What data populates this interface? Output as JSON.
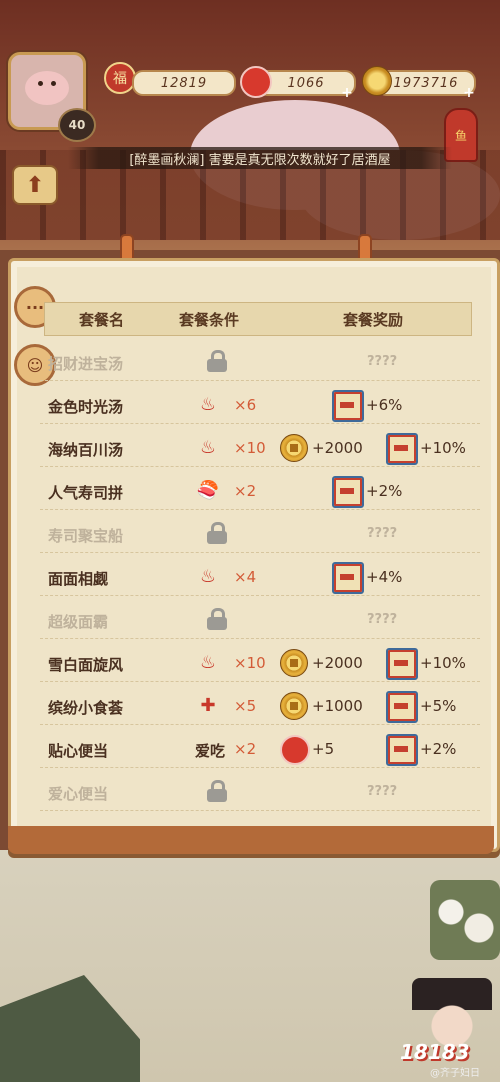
{
  "hud": {
    "level": "40",
    "flower_badge": "福",
    "score": "12819",
    "tickets": "1066",
    "coins": "1973716",
    "ticket_plus": "+",
    "coin_plus": "+",
    "fish_label": "鱼"
  },
  "banner": "[醉墨画秋澜] 害要是真无限次数就好了居酒屋",
  "table": {
    "col_name": "套餐名",
    "col_condition": "套餐条件",
    "col_reward": "套餐奖励",
    "rows": [
      {
        "name": "招财进宝汤",
        "locked": true,
        "reward": "????"
      },
      {
        "name": "金色时光汤",
        "cond_icon": "soup-bowl-icon",
        "qty": "×6",
        "reward": "+6%"
      },
      {
        "name": "海纳百川汤",
        "cond_icon": "soup-bowl-icon",
        "qty": "×10",
        "coin_reward": "+2000",
        "reward": "+10%"
      },
      {
        "name": "人气寿司拼",
        "cond_icon": "sushi-icon",
        "qty": "×2",
        "reward": "+2%"
      },
      {
        "name": "寿司聚宝船",
        "locked": true,
        "reward": "????"
      },
      {
        "name": "面面相觑",
        "cond_icon": "noodle-icon",
        "qty": "×4",
        "reward": "+4%"
      },
      {
        "name": "超级面霸",
        "locked": true,
        "reward": "????"
      },
      {
        "name": "雪白面旋风",
        "cond_icon": "noodle-icon",
        "qty": "×10",
        "coin_reward": "+2000",
        "reward": "+10%"
      },
      {
        "name": "缤纷小食荟",
        "cond_icon": "skewer-icon",
        "qty": "×5",
        "coin_reward": "+1000",
        "reward": "+5%"
      },
      {
        "name": "贴心便当",
        "cond_text": "爱吃",
        "qty": "×2",
        "love_reward": "+5",
        "reward": "+2%"
      },
      {
        "name": "爱心便当",
        "locked": true,
        "reward": "????"
      }
    ]
  },
  "logo": "18183",
  "watermark": "@齐子妇日"
}
